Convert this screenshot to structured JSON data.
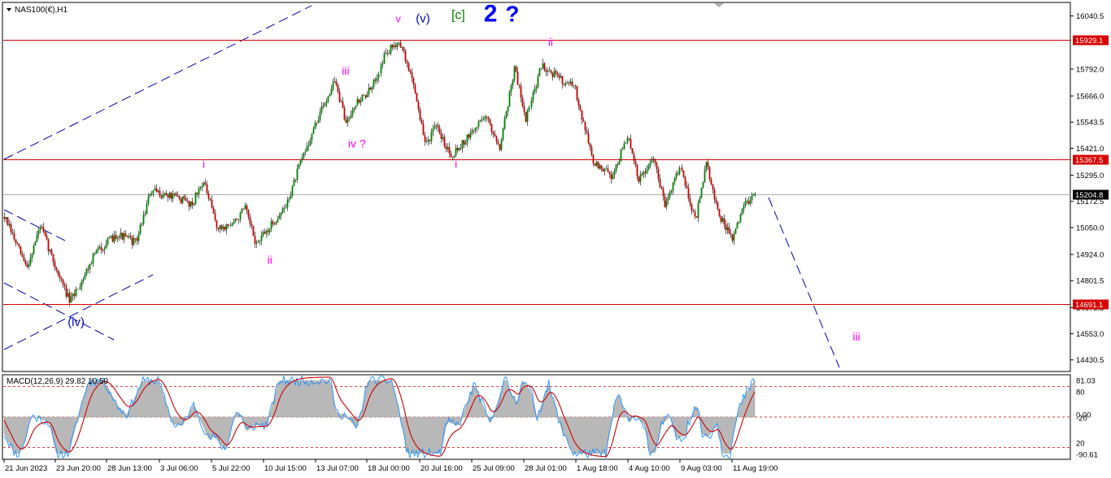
{
  "chart_data": {
    "type": "candlestick",
    "symbol_label": "NAS100(€),H1",
    "price_axis": {
      "ticks": [
        "16040.5",
        "15792.0",
        "15666.0",
        "15543.5",
        "15421.0",
        "15295.0",
        "15172.5",
        "15050.0",
        "14924.0",
        "14801.5",
        "14675.5",
        "14553.0",
        "14430.5"
      ],
      "range": [
        14380,
        16100
      ]
    },
    "time_axis": {
      "ticks": [
        "21 Jun 2023",
        "23 Jun 20:00",
        "28 Jun 13:00",
        "3 Jul 06:00",
        "5 Jul 22:00",
        "10 Jul 15:00",
        "13 Jul 07:00",
        "18 Jul 00:00",
        "20 Jul 16:00",
        "25 Jul 09:00",
        "28 Jul 01:00",
        "1 Aug 18:00",
        "4 Aug 10:00",
        "9 Aug 03:00",
        "11 Aug 19:00"
      ]
    },
    "price_path": [
      {
        "t": 0,
        "p": 15100
      },
      {
        "t": 0.03,
        "p": 14860
      },
      {
        "t": 0.048,
        "p": 15060
      },
      {
        "t": 0.07,
        "p": 14850
      },
      {
        "t": 0.088,
        "p": 14700
      },
      {
        "t": 0.12,
        "p": 14930
      },
      {
        "t": 0.15,
        "p": 15020
      },
      {
        "t": 0.175,
        "p": 14980
      },
      {
        "t": 0.195,
        "p": 15220
      },
      {
        "t": 0.23,
        "p": 15190
      },
      {
        "t": 0.25,
        "p": 15160
      },
      {
        "t": 0.265,
        "p": 15270
      },
      {
        "t": 0.285,
        "p": 15040
      },
      {
        "t": 0.305,
        "p": 15070
      },
      {
        "t": 0.32,
        "p": 15140
      },
      {
        "t": 0.335,
        "p": 14970
      },
      {
        "t": 0.355,
        "p": 15060
      },
      {
        "t": 0.375,
        "p": 15150
      },
      {
        "t": 0.395,
        "p": 15360
      },
      {
        "t": 0.42,
        "p": 15580
      },
      {
        "t": 0.44,
        "p": 15740
      },
      {
        "t": 0.455,
        "p": 15540
      },
      {
        "t": 0.465,
        "p": 15620
      },
      {
        "t": 0.49,
        "p": 15700
      },
      {
        "t": 0.505,
        "p": 15850
      },
      {
        "t": 0.525,
        "p": 15930
      },
      {
        "t": 0.545,
        "p": 15720
      },
      {
        "t": 0.56,
        "p": 15440
      },
      {
        "t": 0.575,
        "p": 15520
      },
      {
        "t": 0.595,
        "p": 15390
      },
      {
        "t": 0.62,
        "p": 15480
      },
      {
        "t": 0.64,
        "p": 15580
      },
      {
        "t": 0.66,
        "p": 15430
      },
      {
        "t": 0.68,
        "p": 15800
      },
      {
        "t": 0.695,
        "p": 15560
      },
      {
        "t": 0.715,
        "p": 15810
      },
      {
        "t": 0.735,
        "p": 15760
      },
      {
        "t": 0.76,
        "p": 15700
      },
      {
        "t": 0.785,
        "p": 15350
      },
      {
        "t": 0.81,
        "p": 15290
      },
      {
        "t": 0.83,
        "p": 15480
      },
      {
        "t": 0.845,
        "p": 15270
      },
      {
        "t": 0.865,
        "p": 15370
      },
      {
        "t": 0.88,
        "p": 15160
      },
      {
        "t": 0.9,
        "p": 15340
      },
      {
        "t": 0.92,
        "p": 15080
      },
      {
        "t": 0.935,
        "p": 15350
      },
      {
        "t": 0.95,
        "p": 15120
      },
      {
        "t": 0.97,
        "p": 14990
      },
      {
        "t": 0.985,
        "p": 15160
      },
      {
        "t": 1.0,
        "p": 15204.8
      }
    ],
    "horizontal_levels": [
      {
        "price": 15929.1,
        "label": "15929.1",
        "color": "#d60000"
      },
      {
        "price": 15367.5,
        "label": "15367.5",
        "color": "#d60000"
      },
      {
        "price": 14691.1,
        "label": "14691.1",
        "color": "#d60000"
      },
      {
        "price": 15204.8,
        "label": "15204.8",
        "color": "#b0b0b0",
        "current": true
      }
    ],
    "wave_labels": [
      {
        "text": "v",
        "t": 0.525,
        "p": 16010,
        "color": "#ff00ff",
        "size": 13
      },
      {
        "text": "(v)",
        "t": 0.558,
        "p": 16010,
        "color": "#0000cc",
        "size": 15
      },
      {
        "text": "[c]",
        "t": 0.605,
        "p": 16025,
        "color": "#008000",
        "size": 16
      },
      {
        "text": "2",
        "t": 0.648,
        "p": 16015,
        "color": "#0000ff",
        "size": 30
      },
      {
        "text": "?",
        "t": 0.677,
        "p": 16015,
        "color": "#0000ff",
        "size": 28
      },
      {
        "text": "iii",
        "t": 0.455,
        "p": 15765,
        "color": "#ff00ff",
        "size": 14
      },
      {
        "text": "iv ?",
        "t": 0.47,
        "p": 15425,
        "color": "#ff00ff",
        "size": 14
      },
      {
        "text": "i",
        "t": 0.266,
        "p": 15330,
        "color": "#ff00ff",
        "size": 14
      },
      {
        "text": "ii",
        "t": 0.354,
        "p": 14880,
        "color": "#ff00ff",
        "size": 14
      },
      {
        "text": "i",
        "t": 0.602,
        "p": 15330,
        "color": "#ff00ff",
        "size": 14
      },
      {
        "text": "ii",
        "t": 0.728,
        "p": 15900,
        "color": "#ff00ff",
        "size": 14
      },
      {
        "text": "(iv)",
        "t": 0.096,
        "p": 14590,
        "color": "#0000cc",
        "size": 15
      },
      {
        "text": "iii",
        "p": 14520,
        "color": "#ff00ff",
        "size": 14,
        "proj": true
      }
    ],
    "macd": {
      "label": "MACD(12,26,9) 29.82 10.59",
      "ticks": [
        "81.03",
        "80",
        "0.00",
        "-20",
        "20",
        "-90.61"
      ],
      "levels": [
        80,
        0,
        -80
      ]
    },
    "colors": {
      "bull": "#008000",
      "bear": "#c00000",
      "wick": "#202020",
      "trendline": "#0000aa",
      "macd_hist": "#b8b8b8",
      "macd_signal": "#1e90ff",
      "macd_line": "#d00000",
      "level_dotted": "#d00000"
    }
  }
}
